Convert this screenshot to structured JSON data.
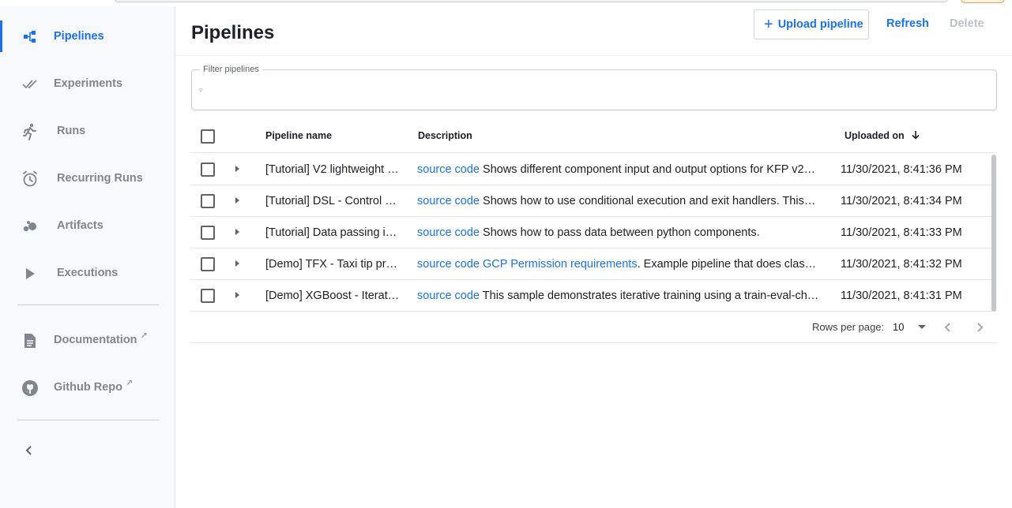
{
  "sidebar": {
    "items": [
      {
        "label": "Pipelines",
        "icon": "pipeline-icon",
        "active": true
      },
      {
        "label": "Experiments",
        "icon": "double-check-icon"
      },
      {
        "label": "Runs",
        "icon": "running-person-icon"
      },
      {
        "label": "Recurring Runs",
        "icon": "alarm-clock-icon"
      },
      {
        "label": "Artifacts",
        "icon": "bubbles-icon"
      },
      {
        "label": "Executions",
        "icon": "play-icon"
      }
    ],
    "external": [
      {
        "label": "Documentation",
        "icon": "document-icon"
      },
      {
        "label": "Github Repo",
        "icon": "github-icon"
      }
    ]
  },
  "header": {
    "title": "Pipelines",
    "upload_label": "Upload pipeline",
    "refresh_label": "Refresh",
    "delete_label": "Delete"
  },
  "filter": {
    "label": "Filter pipelines",
    "value": ""
  },
  "table": {
    "columns": {
      "name": "Pipeline name",
      "description": "Description",
      "uploaded": "Uploaded on"
    },
    "rows": [
      {
        "name": "[Tutorial] V2 lightweight …",
        "links": [
          "source code"
        ],
        "description": "Shows different component input and output options for KFP v2…",
        "uploaded": "11/30/2021, 8:41:36 PM"
      },
      {
        "name": "[Tutorial] DSL - Control …",
        "links": [
          "source code"
        ],
        "description": "Shows how to use conditional execution and exit handlers. This…",
        "uploaded": "11/30/2021, 8:41:34 PM"
      },
      {
        "name": "[Tutorial] Data passing i…",
        "links": [
          "source code"
        ],
        "description": "Shows how to pass data between python components.",
        "uploaded": "11/30/2021, 8:41:33 PM"
      },
      {
        "name": "[Demo] TFX - Taxi tip pr…",
        "links": [
          "source code",
          "GCP Permission requirements"
        ],
        "description": ". Example pipeline that does clas…",
        "uploaded": "11/30/2021, 8:41:32 PM"
      },
      {
        "name": "[Demo] XGBoost - Iterat…",
        "links": [
          "source code"
        ],
        "description": "This sample demonstrates iterative training using a train-eval-ch…",
        "uploaded": "11/30/2021, 8:41:31 PM"
      }
    ]
  },
  "pagination": {
    "rows_per_page_label": "Rows per page:",
    "rows_per_page": "10"
  },
  "colors": {
    "accent": "#1a73e8",
    "sidebar_bg": "#f8f9fa",
    "muted": "#80868b"
  }
}
